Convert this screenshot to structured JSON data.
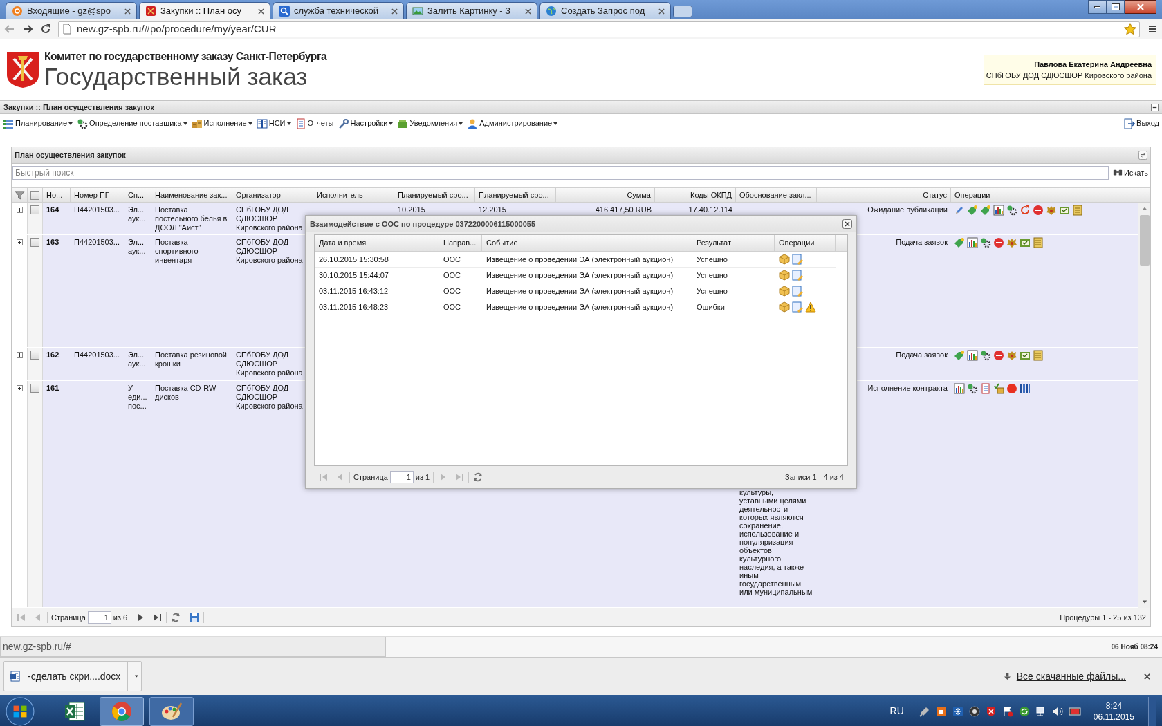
{
  "browser": {
    "tabs": [
      {
        "title": "Входящие - gz@spo",
        "selected": false,
        "kind": "mail"
      },
      {
        "title": "Закупки :: План осу",
        "selected": true,
        "kind": "emblem"
      },
      {
        "title": "служба технической",
        "selected": false,
        "kind": "search"
      },
      {
        "title": "Залить Картинку - З",
        "selected": false,
        "kind": "image"
      },
      {
        "title": "Создать Запрос под",
        "selected": false,
        "kind": "globe"
      }
    ],
    "url": "new.gz-spb.ru/#po/procedure/my/year/CUR",
    "status_url": "new.gz-spb.ru/#"
  },
  "header": {
    "committee": "Комитет по государственному заказу Санкт-Петербурга",
    "title": "Государственный заказ",
    "user": {
      "name": "Павлова Екатерина Андреевна",
      "org": "СПбГОБУ ДОД СДЮСШОР Кировского района"
    }
  },
  "app_title": "Закупки :: План осуществления закупок",
  "menu": [
    {
      "label": "Планирование",
      "kind": "list",
      "dropdown": true
    },
    {
      "label": "Определение поставщика",
      "kind": "gears",
      "dropdown": true
    },
    {
      "label": "Исполнение",
      "kind": "boxes",
      "dropdown": true
    },
    {
      "label": "НСИ",
      "kind": "book",
      "dropdown": true
    },
    {
      "label": "Отчеты",
      "kind": "doc",
      "dropdown": false
    },
    {
      "label": "Настройки",
      "kind": "wrench",
      "dropdown": true
    },
    {
      "label": "Уведомления",
      "kind": "greenbox",
      "dropdown": true
    },
    {
      "label": "Администрирование",
      "kind": "person",
      "dropdown": true
    }
  ],
  "exit": "Выход",
  "panel": {
    "title": "План осуществления закупок",
    "search": {
      "placeholder": "Быстрый поиск",
      "button": "Искать"
    },
    "select_all": {
      "checked": false
    },
    "columns": [
      "Но...",
      "Номер ПГ",
      "Сп...",
      "Наименование зак...",
      "Организатор",
      "Исполнитель",
      "Планируемый сро...",
      "Планируемый сро...",
      "Сумма",
      "Коды ОКПД",
      "Обоснование закл...",
      "Статус",
      "Операции"
    ],
    "rows": [
      {
        "no": "164",
        "pg": "П44201503...",
        "method": "Эл... аук...",
        "name": "Поставка постельного белья в ДООЛ \"Аист\"",
        "organizer": "СПбГОБУ ДОД СДЮСШОР Кировского района",
        "plan_start": "10.2015",
        "plan_end": "12.2015",
        "sum": "416 417,50 RUB",
        "okpd": "17.40.12.114",
        "status": "Ожидание публикации",
        "expanded": false,
        "checked": false,
        "operations": [
          {
            "kind": "pencil"
          },
          {
            "kind": "tag"
          },
          {
            "kind": "tag"
          },
          {
            "kind": "chart"
          },
          {
            "kind": "gears"
          },
          {
            "kind": "refresh"
          },
          {
            "kind": "stop"
          },
          {
            "kind": "emblem"
          },
          {
            "kind": "approve"
          },
          {
            "kind": "scroll"
          }
        ]
      },
      {
        "no": "163",
        "pg": "П44201503...",
        "method": "Эл... аук...",
        "name": "Поставка спортивного инвентаря",
        "organizer": "СПбГОБУ ДОД СДЮСШОР Кировского района",
        "status": "Подача заявок",
        "expanded": false,
        "checked": false,
        "operations": [
          {
            "kind": "tag"
          },
          {
            "kind": "chart"
          },
          {
            "kind": "gears"
          },
          {
            "kind": "stop"
          },
          {
            "kind": "emblem"
          },
          {
            "kind": "approve"
          },
          {
            "kind": "scroll"
          }
        ]
      },
      {
        "no": "162",
        "pg": "П44201503...",
        "method": "Эл... аук...",
        "name": "Поставка резиновой крошки",
        "organizer": "СПбГОБУ ДОД СДЮСШОР Кировского района",
        "status": "Подача заявок",
        "expanded": false,
        "checked": false,
        "operations": [
          {
            "kind": "tag"
          },
          {
            "kind": "chart"
          },
          {
            "kind": "gears"
          },
          {
            "kind": "stop"
          },
          {
            "kind": "emblem"
          },
          {
            "kind": "approve"
          },
          {
            "kind": "scroll"
          }
        ]
      },
      {
        "no": "161",
        "method": "У еди... пос...",
        "name": "Поставка CD-RW дисков",
        "organizer": "СПбГОБУ ДОД СДЮСШОР Кировского района",
        "justification": "культуры, уставными целями деятельности которых являются сохранение, использование и популяризация объектов культурного наследия, а также иным государственным или муниципальным",
        "status": "Исполнение контракта",
        "expanded": false,
        "checked": false,
        "operations": [
          {
            "kind": "chart"
          },
          {
            "kind": "gears"
          },
          {
            "kind": "doc"
          },
          {
            "kind": "sign"
          },
          {
            "kind": "record"
          },
          {
            "kind": "books"
          }
        ]
      }
    ],
    "pager": {
      "label": "Страница",
      "page": "1",
      "of": "из 6",
      "prev_enabled": false,
      "next_enabled": true,
      "summary": "Процедуры 1 - 25 из 132"
    }
  },
  "dialog": {
    "title": "Взаимодействие с ООС по процедуре 0372200006115000055",
    "columns": [
      "Дата и время",
      "Направ...",
      "Событие",
      "Результат",
      "Операции"
    ],
    "rows": [
      {
        "datetime": "26.10.2015 15:30:58",
        "direction": "ООС",
        "event": "Извещение о проведении ЭА (электронный аукцион)",
        "result": "Успешно",
        "warning": false
      },
      {
        "datetime": "30.10.2015 15:44:07",
        "direction": "ООС",
        "event": "Извещение о проведении ЭА (электронный аукцион)",
        "result": "Успешно",
        "warning": false
      },
      {
        "datetime": "03.11.2015 16:43:12",
        "direction": "ООС",
        "event": "Извещение о проведении ЭА (электронный аукцион)",
        "result": "Успешно",
        "warning": false
      },
      {
        "datetime": "03.11.2015 16:48:23",
        "direction": "ООС",
        "event": "Извещение о проведении ЭА (электронный аукцион)",
        "result": "Ошибки",
        "warning": true
      }
    ],
    "pager": {
      "label": "Страница",
      "page": "1",
      "of": "из 1",
      "prev_enabled": false,
      "next_enabled": false,
      "summary": "Записи 1 - 4 из 4"
    }
  },
  "clock_bar": "06 Нояб 08:24",
  "downloads": {
    "file": "-сделать скри....docx",
    "all": "Все скачанные файлы..."
  },
  "taskbar": {
    "lang": "RU",
    "time": "8:24",
    "date": "06.11.2015"
  }
}
